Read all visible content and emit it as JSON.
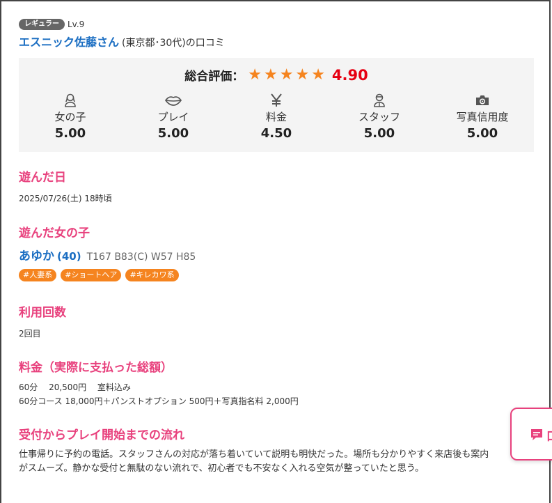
{
  "reviewer": {
    "rank_badge": "レギュラー",
    "level": "Lv.9",
    "name": "エスニック佐藤さん",
    "meta": "(東京都･30代)の口コミ"
  },
  "rating": {
    "overall_label": "総合評価：",
    "overall_stars": 5,
    "overall_score": "4.90",
    "categories": [
      {
        "icon": "girl-icon",
        "label": "女の子",
        "score": "5.00"
      },
      {
        "icon": "lips-icon",
        "label": "プレイ",
        "score": "5.00"
      },
      {
        "icon": "yen-icon",
        "label": "料金",
        "score": "4.50"
      },
      {
        "icon": "staff-icon",
        "label": "スタッフ",
        "score": "5.00"
      },
      {
        "icon": "camera-icon",
        "label": "写真信用度",
        "score": "5.00"
      }
    ]
  },
  "visit_date": {
    "title": "遊んだ日",
    "value": "2025/07/26(土) 18時頃"
  },
  "girl": {
    "title": "遊んだ女の子",
    "name": "あゆか",
    "age": "(40)",
    "spec": "T167 B83(C) W57 H85",
    "tags": [
      "#人妻系",
      "#ショートヘア",
      "#キレカワ系"
    ]
  },
  "usage": {
    "title": "利用回数",
    "value": "2回目"
  },
  "price": {
    "title": "料金（実際に支払った総額）",
    "line1": "60分　 20,500円　 室料込み",
    "line2": "60分コース 18,000円＋パンストオプション 500円＋写真指名料 2,000円"
  },
  "flow": {
    "title": "受付からプレイ開始までの流れ",
    "line1": "仕事帰りに予約の電話。スタッフさんの対応が落ち着いていて説明も明快だった。場所も分かりやすく来店後も案内",
    "line2": "がスムーズ。静かな受付と無駄のない流れで、初心者でも不安なく入れる空気が整っていたと思う。"
  },
  "float_button": {
    "label": "口"
  },
  "colors": {
    "accent_pink": "#e8417d",
    "link_blue": "#1b6ec2",
    "star_orange": "#f5841f",
    "score_red": "#e60012"
  }
}
